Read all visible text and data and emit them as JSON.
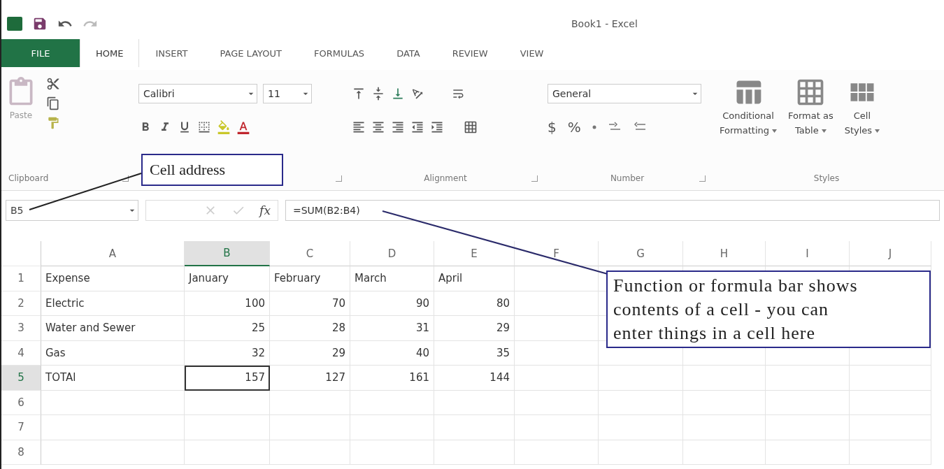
{
  "window": {
    "title": "Book1 - Excel"
  },
  "file_tab": "FILE",
  "tabs": [
    {
      "label": "HOME",
      "selected": true
    },
    {
      "label": "INSERT",
      "selected": false
    },
    {
      "label": "PAGE LAYOUT",
      "selected": false
    },
    {
      "label": "FORMULAS",
      "selected": false
    },
    {
      "label": "DATA",
      "selected": false
    },
    {
      "label": "REVIEW",
      "selected": false
    },
    {
      "label": "VIEW",
      "selected": false
    }
  ],
  "ribbon": {
    "clipboard": {
      "paste_label": "Paste",
      "group_label": "Clipboard"
    },
    "font": {
      "font_name": "Calibri",
      "font_size": "11"
    },
    "alignment": {
      "group_label": "Alignment"
    },
    "number": {
      "format": "General",
      "currency": "$",
      "percent": "%",
      "group_label": "Number"
    },
    "styles": {
      "buttons": [
        {
          "line1": "Conditional",
          "line2": "Formatting"
        },
        {
          "line1": "Format as",
          "line2": "Table"
        },
        {
          "line1": "Cell",
          "line2": "Styles"
        }
      ],
      "group_label": "Styles"
    }
  },
  "formula_bar": {
    "name_box": "B5",
    "fx": "fx",
    "formula": "=SUM(B2:B4)"
  },
  "sheet": {
    "columns": [
      {
        "label": "A",
        "selected": false
      },
      {
        "label": "B",
        "selected": true
      },
      {
        "label": "C",
        "selected": false
      },
      {
        "label": "D",
        "selected": false
      },
      {
        "label": "E",
        "selected": false
      },
      {
        "label": "F",
        "selected": false
      },
      {
        "label": "G",
        "selected": false
      },
      {
        "label": "H",
        "selected": false
      },
      {
        "label": "I",
        "selected": false
      },
      {
        "label": "J",
        "selected": false
      }
    ],
    "rows": [
      {
        "number": "1",
        "selected": false,
        "kind": "header",
        "cells": [
          {
            "text": "Expense",
            "selected": false
          },
          {
            "text": "January",
            "selected": false
          },
          {
            "text": "February",
            "selected": false
          },
          {
            "text": "March",
            "selected": false
          },
          {
            "text": "April",
            "selected": false
          }
        ]
      },
      {
        "number": "2",
        "selected": false,
        "kind": "data",
        "cells": [
          {
            "text": "Electric",
            "selected": false
          },
          {
            "text": "100",
            "selected": false
          },
          {
            "text": "70",
            "selected": false
          },
          {
            "text": "90",
            "selected": false
          },
          {
            "text": "80",
            "selected": false
          }
        ]
      },
      {
        "number": "3",
        "selected": false,
        "kind": "data",
        "cells": [
          {
            "text": "Water and Sewer",
            "selected": false
          },
          {
            "text": "25",
            "selected": false
          },
          {
            "text": "28",
            "selected": false
          },
          {
            "text": "31",
            "selected": false
          },
          {
            "text": "29",
            "selected": false
          }
        ]
      },
      {
        "number": "4",
        "selected": false,
        "kind": "data",
        "cells": [
          {
            "text": "Gas",
            "selected": false
          },
          {
            "text": "32",
            "selected": false
          },
          {
            "text": "29",
            "selected": false
          },
          {
            "text": "40",
            "selected": false
          },
          {
            "text": "35",
            "selected": false
          }
        ]
      },
      {
        "number": "5",
        "selected": true,
        "kind": "data",
        "cells": [
          {
            "text": "TOTAl",
            "selected": false
          },
          {
            "text": "157",
            "selected": true
          },
          {
            "text": "127",
            "selected": false
          },
          {
            "text": "161",
            "selected": false
          },
          {
            "text": "144",
            "selected": false
          }
        ]
      },
      {
        "number": "6",
        "selected": false
      },
      {
        "number": "7",
        "selected": false
      },
      {
        "number": "8",
        "selected": false
      }
    ]
  },
  "callouts": [
    {
      "text": "Cell address"
    },
    {
      "text": "Function or formula bar shows contents of a cell - you can enter things in a cell here"
    }
  ]
}
